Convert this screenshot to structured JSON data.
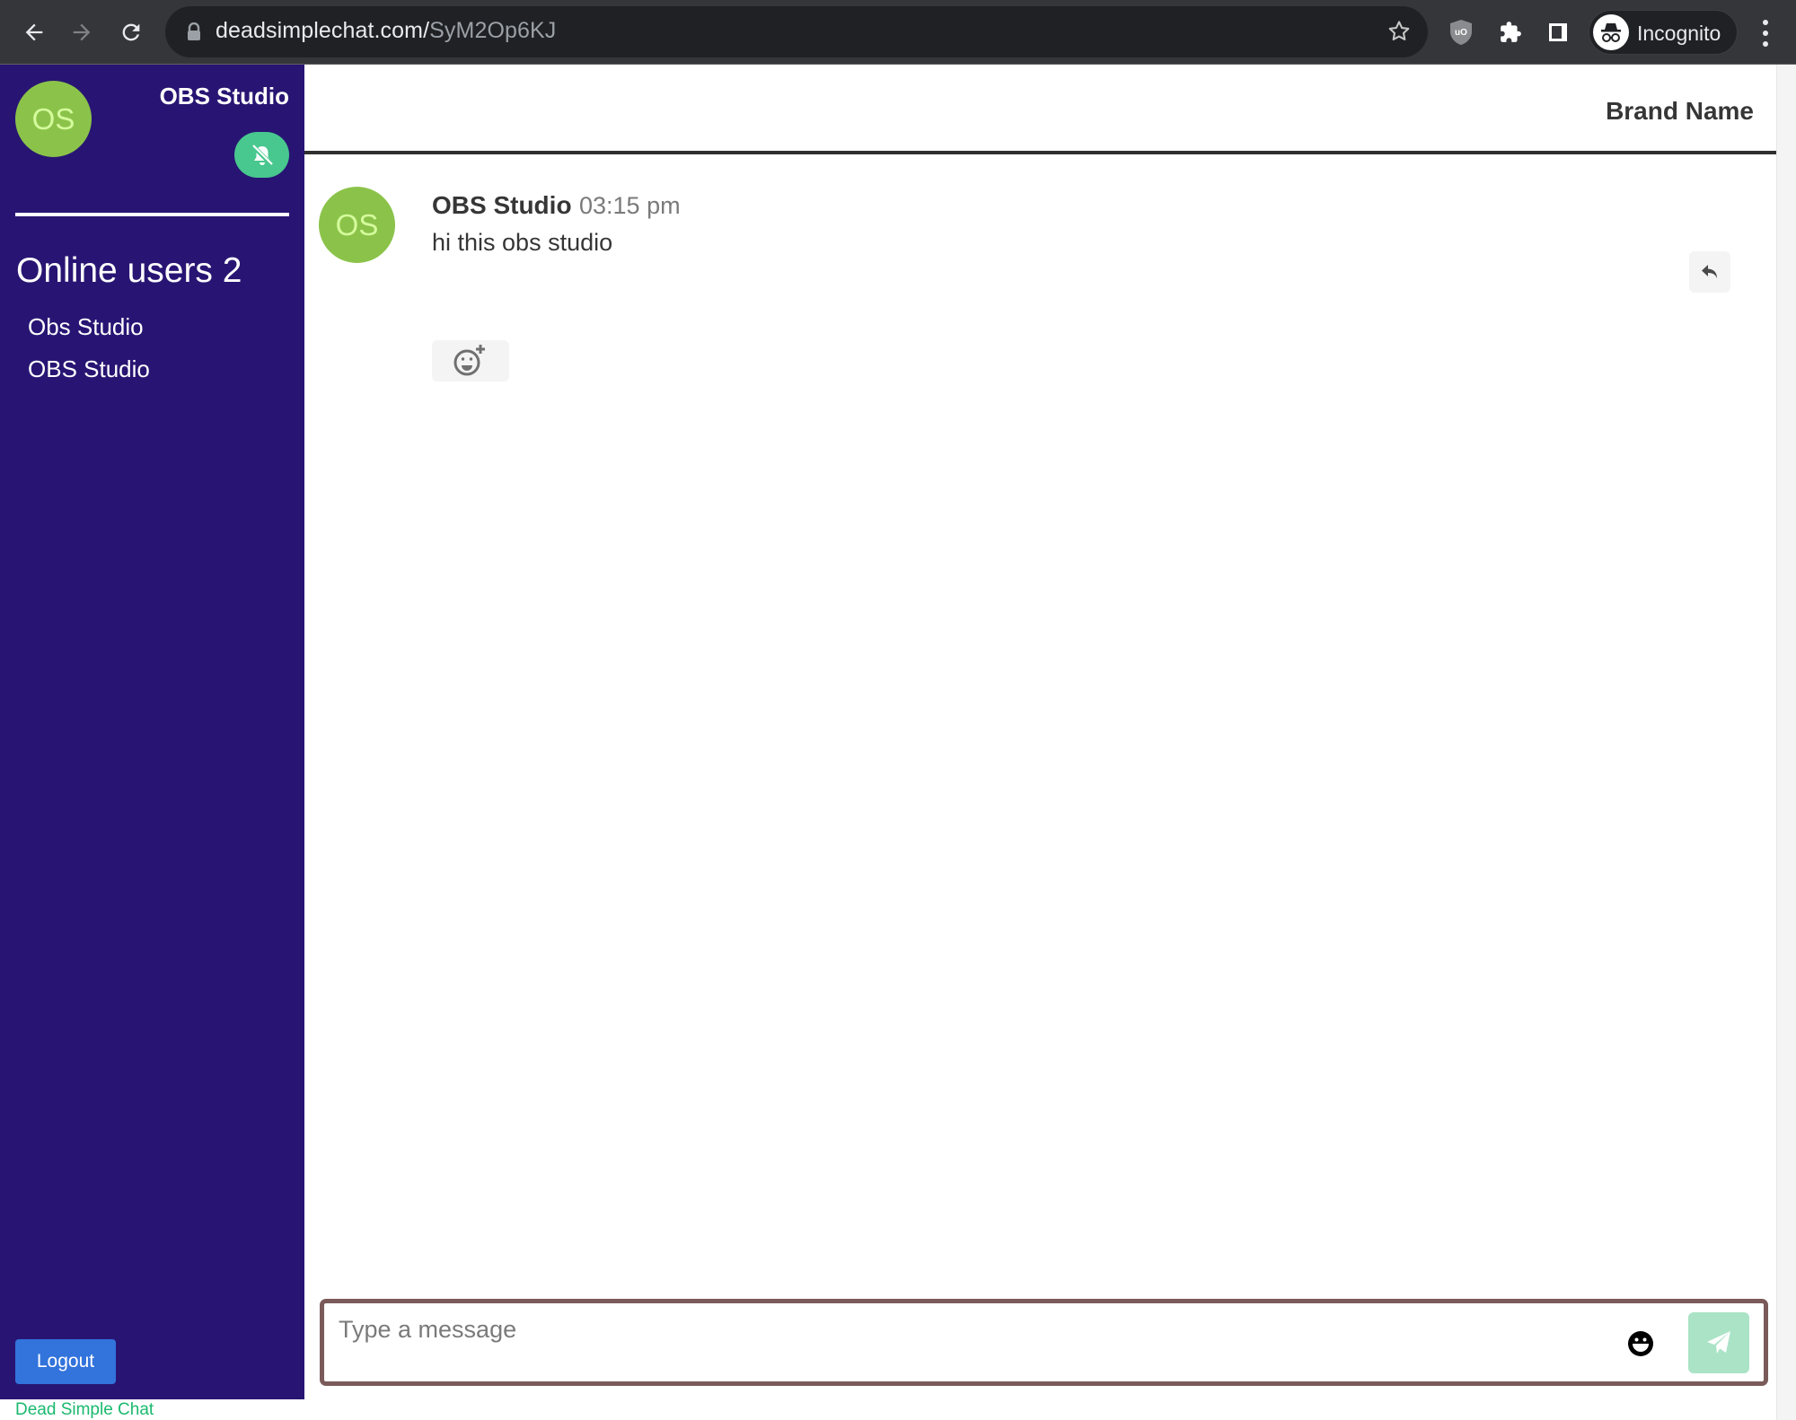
{
  "browser": {
    "url_host": "deadsimplechat.com/",
    "url_path": "SyM2Op6KJ",
    "profile_label": "Incognito",
    "icons": [
      "back-arrow-icon",
      "forward-arrow-icon",
      "reload-icon",
      "lock-icon",
      "star-icon",
      "ublock-shield-icon",
      "extensions-puzzle-icon",
      "side-panel-icon",
      "incognito-icon",
      "menu-dots-icon"
    ]
  },
  "sidebar": {
    "current_user": {
      "initials": "OS",
      "name": "OBS Studio",
      "avatar_color": "#8bc34a"
    },
    "notification_toggle": {
      "icon": "bell-slash-icon",
      "state": "muted",
      "color": "#48c78e"
    },
    "online_title": "Online users 2",
    "online_users": [
      {
        "name": "Obs Studio"
      },
      {
        "name": "OBS Studio"
      }
    ],
    "logout_label": "Logout",
    "footer_brand": "Dead Simple Chat",
    "background_color": "#281573"
  },
  "chat": {
    "brand_name": "Brand Name",
    "messages": [
      {
        "initials": "OS",
        "author": "OBS Studio",
        "time": "03:15 pm",
        "text": "hi this obs studio",
        "react_icon": "add-reaction-icon",
        "reply_icon": "reply-icon"
      }
    ],
    "composer": {
      "placeholder": "Type a message",
      "value": "",
      "emoji_icon": "emoji-icon",
      "send_icon": "paper-plane-icon"
    }
  }
}
